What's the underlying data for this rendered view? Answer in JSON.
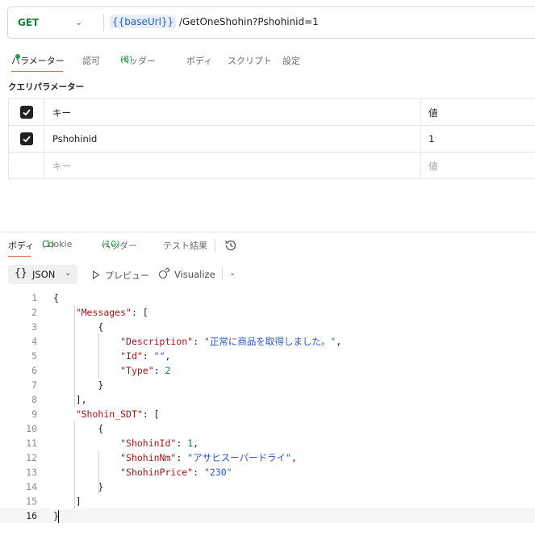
{
  "request": {
    "method": "GET",
    "url_var": "{{baseUrl}}",
    "url_rest": " /GetOneShohin?Pshohinid=1"
  },
  "request_tabs": [
    {
      "label": "パラメーター",
      "active": true,
      "indicator": "dot"
    },
    {
      "label": "認可"
    },
    {
      "label": "ヘッダー",
      "count": "(8)"
    },
    {
      "label": "ボディ"
    },
    {
      "label": "スクリプト"
    },
    {
      "label": "設定"
    }
  ],
  "query_params": {
    "section_label": "クエリパラメーター",
    "header": {
      "key": "キー",
      "value": "値",
      "checked": true
    },
    "rows": [
      {
        "key": "Pshohinid",
        "value": "1",
        "checked": true
      }
    ],
    "placeholder": {
      "key": "キー",
      "value": "値"
    }
  },
  "response_tabs": [
    {
      "label": "ボディ",
      "active": true
    },
    {
      "label": "Cookie",
      "count": "(1)"
    },
    {
      "label": "ヘッダー",
      "count": "(10)"
    },
    {
      "label": "テスト結果"
    }
  ],
  "body_toolbar": {
    "format_icon": "{}",
    "format": "JSON",
    "preview": "プレビュー",
    "visualize": "Visualize"
  },
  "code_lines": [
    {
      "n": "1",
      "tokens": [
        [
          "{",
          "p"
        ]
      ]
    },
    {
      "n": "2",
      "tokens": [
        [
          "    ",
          "p"
        ],
        [
          "\"Messages\"",
          "k"
        ],
        [
          ": [",
          "p"
        ]
      ]
    },
    {
      "n": "3",
      "tokens": [
        [
          "        {",
          "p"
        ]
      ]
    },
    {
      "n": "4",
      "tokens": [
        [
          "            ",
          "p"
        ],
        [
          "\"Description\"",
          "k"
        ],
        [
          ": ",
          "p"
        ],
        [
          "\"正常に商品を取得しました。\"",
          "s"
        ],
        [
          ",",
          "p"
        ]
      ]
    },
    {
      "n": "5",
      "tokens": [
        [
          "            ",
          "p"
        ],
        [
          "\"Id\"",
          "k"
        ],
        [
          ": ",
          "p"
        ],
        [
          "\"\"",
          "s"
        ],
        [
          ",",
          "p"
        ]
      ]
    },
    {
      "n": "6",
      "tokens": [
        [
          "            ",
          "p"
        ],
        [
          "\"Type\"",
          "k"
        ],
        [
          ": ",
          "p"
        ],
        [
          "2",
          "n"
        ]
      ]
    },
    {
      "n": "7",
      "tokens": [
        [
          "        }",
          "p"
        ]
      ]
    },
    {
      "n": "8",
      "tokens": [
        [
          "    ],",
          "p"
        ]
      ]
    },
    {
      "n": "9",
      "tokens": [
        [
          "    ",
          "p"
        ],
        [
          "\"Shohin_SDT\"",
          "k"
        ],
        [
          ": [",
          "p"
        ]
      ]
    },
    {
      "n": "10",
      "tokens": [
        [
          "        {",
          "p"
        ]
      ]
    },
    {
      "n": "11",
      "tokens": [
        [
          "            ",
          "p"
        ],
        [
          "\"ShohinId\"",
          "k"
        ],
        [
          ": ",
          "p"
        ],
        [
          "1",
          "n"
        ],
        [
          ",",
          "p"
        ]
      ]
    },
    {
      "n": "12",
      "tokens": [
        [
          "            ",
          "p"
        ],
        [
          "\"ShohinNm\"",
          "k"
        ],
        [
          ": ",
          "p"
        ],
        [
          "\"アサヒスーパードライ\"",
          "s"
        ],
        [
          ",",
          "p"
        ]
      ]
    },
    {
      "n": "13",
      "tokens": [
        [
          "            ",
          "p"
        ],
        [
          "\"ShohinPrice\"",
          "k"
        ],
        [
          ": ",
          "p"
        ],
        [
          "\"230\"",
          "s"
        ]
      ]
    },
    {
      "n": "14",
      "tokens": [
        [
          "        }",
          "p"
        ]
      ]
    },
    {
      "n": "15",
      "tokens": [
        [
          "    ]",
          "p"
        ]
      ]
    },
    {
      "n": "16",
      "tokens": [
        [
          "}",
          "p"
        ]
      ],
      "current": true
    }
  ],
  "colors": {
    "method": "#1a7f37",
    "accent_underline": "#e86a3a",
    "json_key": "#a31515",
    "json_string": "#2d56c9",
    "json_number": "#098658",
    "url_var": "#2b5ec8"
  }
}
